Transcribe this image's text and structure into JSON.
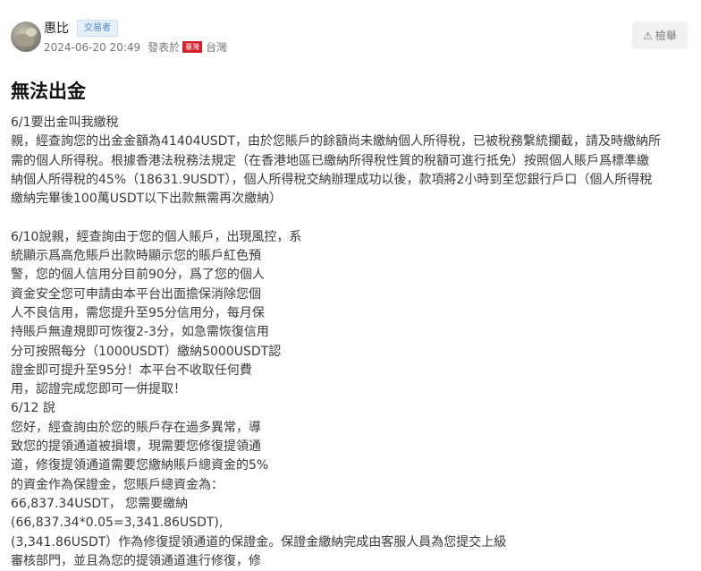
{
  "post": {
    "author": "惠比",
    "badge": "交易者",
    "time": "2024-06-20 20:49",
    "posted_from_label": "發表於",
    "flag_text": "臺灣",
    "location": "台灣",
    "report_label": "檢舉",
    "title": "無法出金",
    "lines": [
      "6/1要出金叫我繳稅",
      "親，經查詢您的出金金額為41404USDT，由於您賬戶的餘額尚未繳納個人所得稅，已被稅務繫統攔截，請及時繳納所",
      "需的個人所得稅。根據香港法稅務法規定（在香港地區已繳納所得稅性質的稅額可進行抵免）按照個人賬戶爲標準繳",
      "納個人所得稅的45%（18631.9USDT），個人所得稅交納辦理成功以後，款項將2小時到至您銀行戶口（個人所得稅",
      "繳納完畢後100萬USDT以下出款無需再次繳納）",
      "",
      "6/10說親，經查詢由于您的個人賬戶，出現風控，系",
      "統顯示爲高危賬戶出款時顯示您的賬戶紅色預",
      "警，您的個人信用分目前90分，爲了您的個人",
      "資金安全您可申請由本平台出面擔保消除您個",
      "人不良信用，需您提升至95分信用分，每月保",
      "持賬戶無違規即可恢復2-3分，如急需恢復信用",
      "分可按照每分（1000USDT）繳納5000USDT認",
      "證金即可提升至95分！本平台不收取任何費",
      "用，認證完成您即可一併提取！",
      "6/12 說",
      "您好，經查詢由於您的賬戶存在過多異常，導",
      "致您的提領通道被損壞，現需要您修復提領通",
      "道，修復提領通道需要您繳納賬戶總資金的5%",
      "的資金作為保證金，您賬戶總資金為：",
      "66,837.34USDT，  您需要繳納",
      "(66,837.34*0.05=3,341.86USDT),",
      "(3,341.86USDT）作為修復提領通道的保證金。保證金繳納完成由客服人員為您提交上級",
      "審核部門，並且為您的提領通道進行修復，修"
    ]
  }
}
